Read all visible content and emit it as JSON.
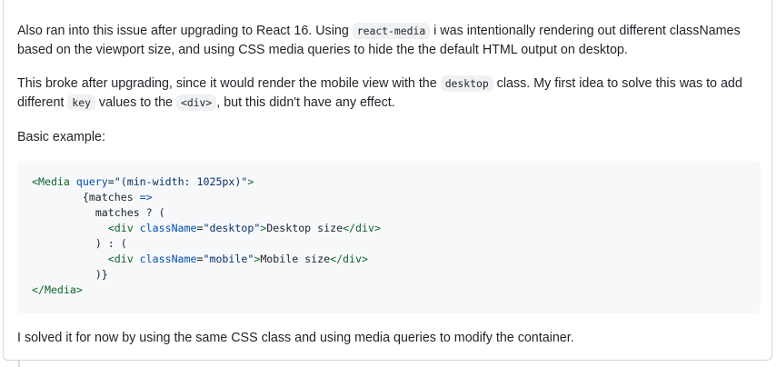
{
  "comment": {
    "p1": {
      "t1": "Also ran into this issue after upgrading to React 16. Using ",
      "code1": "react-media",
      "t2": " i was intentionally rendering out different classNames based on the viewport size, and using CSS media queries to hide the the default HTML output on desktop."
    },
    "p2": {
      "t1": "This broke after upgrading, since it would render the mobile view with the ",
      "code1": "desktop",
      "t2": " class. My first idea to solve this was to add different ",
      "code2": "key",
      "t3": " values to the ",
      "code3": "<div>",
      "t4": ", but this didn't have any effect."
    },
    "p3": "Basic example:",
    "code_block": {
      "l1": {
        "open": "<Media",
        "attr": " query",
        "eq": "=",
        "val": "\"(min-width: 1025px)\"",
        "close": ">"
      },
      "l2": {
        "indent": "        ",
        "text": "{matches ",
        "arrow": "=>"
      },
      "l3": {
        "indent": "          ",
        "text": "matches ? ("
      },
      "l4": {
        "indent": "            ",
        "open": "<div",
        "attr": " className",
        "eq": "=",
        "val": "\"desktop\"",
        "close": ">",
        "inner": "Desktop size",
        "end": "</div>"
      },
      "l5": {
        "indent": "          ",
        "text": ") : ("
      },
      "l6": {
        "indent": "            ",
        "open": "<div",
        "attr": " className",
        "eq": "=",
        "val": "\"mobile\"",
        "close": ">",
        "inner": "Mobile size",
        "end": "</div>"
      },
      "l7": {
        "indent": "          ",
        "text": ")}"
      },
      "l8": {
        "end": "</Media>"
      }
    },
    "p4": "I solved it for now by using the same CSS class and using media queries to modify the container."
  }
}
